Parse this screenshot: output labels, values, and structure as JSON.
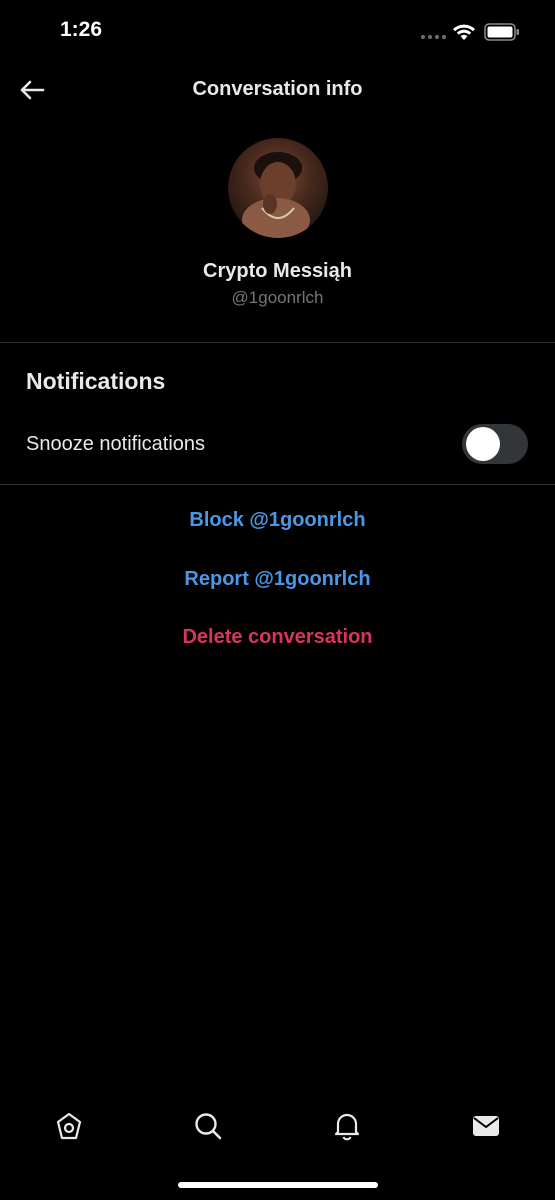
{
  "status_bar": {
    "time": "1:26"
  },
  "header": {
    "title": "Conversation info",
    "back_icon": "arrow-left-icon"
  },
  "profile": {
    "name": "Crypto Messiąh",
    "handle": "@1goonrlch"
  },
  "notifications": {
    "heading": "Notifications",
    "snooze_label": "Snooze notifications",
    "snooze_enabled": false
  },
  "actions": {
    "block": "Block @1goonrlch",
    "report": "Report @1goonrlch",
    "delete": "Delete conversation"
  },
  "tab_bar": {
    "items": [
      {
        "icon": "home-icon",
        "active": false
      },
      {
        "icon": "search-icon",
        "active": false
      },
      {
        "icon": "bell-icon",
        "active": false
      },
      {
        "icon": "mail-icon",
        "active": true
      }
    ]
  },
  "colors": {
    "background": "#000000",
    "text_primary": "#e7e9ea",
    "text_secondary": "#71767b",
    "link_blue": "#4b97e8",
    "danger_red": "#d8355c",
    "divider": "#2f3336"
  }
}
